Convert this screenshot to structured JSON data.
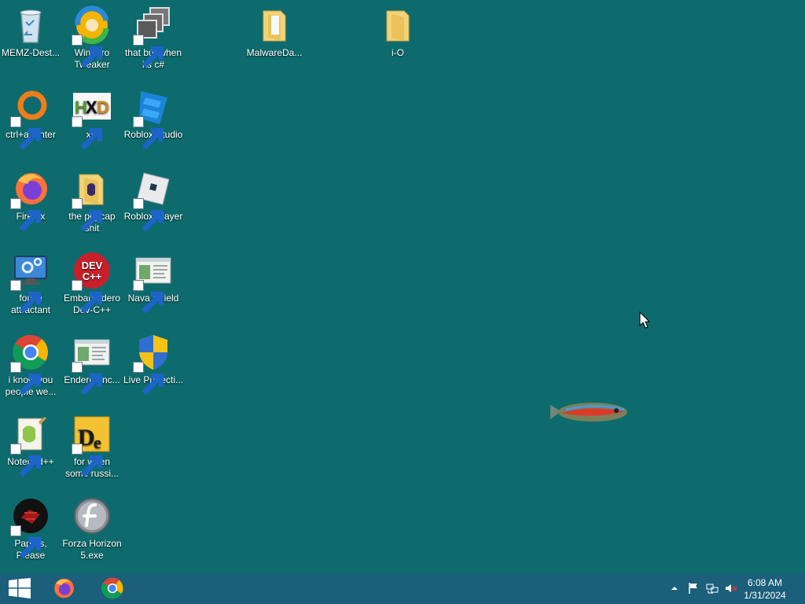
{
  "desktop": {
    "icons": [
      {
        "label": "MEMZ-Dest...",
        "icon": "recycle-bin-icon",
        "shortcut": false
      },
      {
        "label": "Winaero Tweaker",
        "icon": "winaero-icon",
        "shortcut": true
      },
      {
        "label": "that but when its c#",
        "icon": "stacked-windows-icon",
        "shortcut": true
      },
      {
        "label": "MalwareDa...",
        "icon": "folder-icon",
        "shortcut": false
      },
      {
        "label": "i-O",
        "icon": "folder-icon",
        "shortcut": false
      },
      {
        "label": "ctrl+a, enter",
        "icon": "orange-ring-icon",
        "shortcut": true
      },
      {
        "label": "xD",
        "icon": "hxd-icon",
        "shortcut": true
      },
      {
        "label": "Roblox Studio",
        "icon": "roblox-studio-icon",
        "shortcut": true
      },
      {
        "label": "Firefox",
        "icon": "firefox-icon",
        "shortcut": true
      },
      {
        "label": "the popcap shit",
        "icon": "folder-icon",
        "shortcut": true
      },
      {
        "label": "Roblox Player",
        "icon": "roblox-player-icon",
        "shortcut": true
      },
      {
        "label": "forkie attractant",
        "icon": "monitor-gear-icon",
        "shortcut": true
      },
      {
        "label": "Embarcadero Dev-C++",
        "icon": "devcpp-icon",
        "shortcut": true
      },
      {
        "label": "Nava Shield",
        "icon": "window-app-icon",
        "shortcut": true
      },
      {
        "label": "i know you people we...",
        "icon": "chrome-icon",
        "shortcut": true
      },
      {
        "label": "Endermanc...",
        "icon": "window-app-icon",
        "shortcut": true
      },
      {
        "label": "Live Protecti...",
        "icon": "uac-shield-icon",
        "shortcut": true
      },
      {
        "label": "Notepad++",
        "icon": "notepadpp-icon",
        "shortcut": true
      },
      {
        "label": "for when some russi...",
        "icon": "de-icon",
        "shortcut": true
      },
      {
        "label": "Papers, Please",
        "icon": "papers-please-icon",
        "shortcut": true
      },
      {
        "label": "Forza Horizon 5.exe",
        "icon": "flash-icon",
        "shortcut": false
      }
    ]
  },
  "taskbar": {
    "pinned": [
      "start-button",
      "firefox",
      "chrome"
    ],
    "tray": [
      "show-hidden-icons",
      "action-center-flag",
      "network",
      "volume-muted"
    ],
    "time": "6:08 AM",
    "date": "1/31/2024"
  },
  "colors": {
    "desktop": "#0d6b6d",
    "taskbar": "#1b5f7a"
  }
}
